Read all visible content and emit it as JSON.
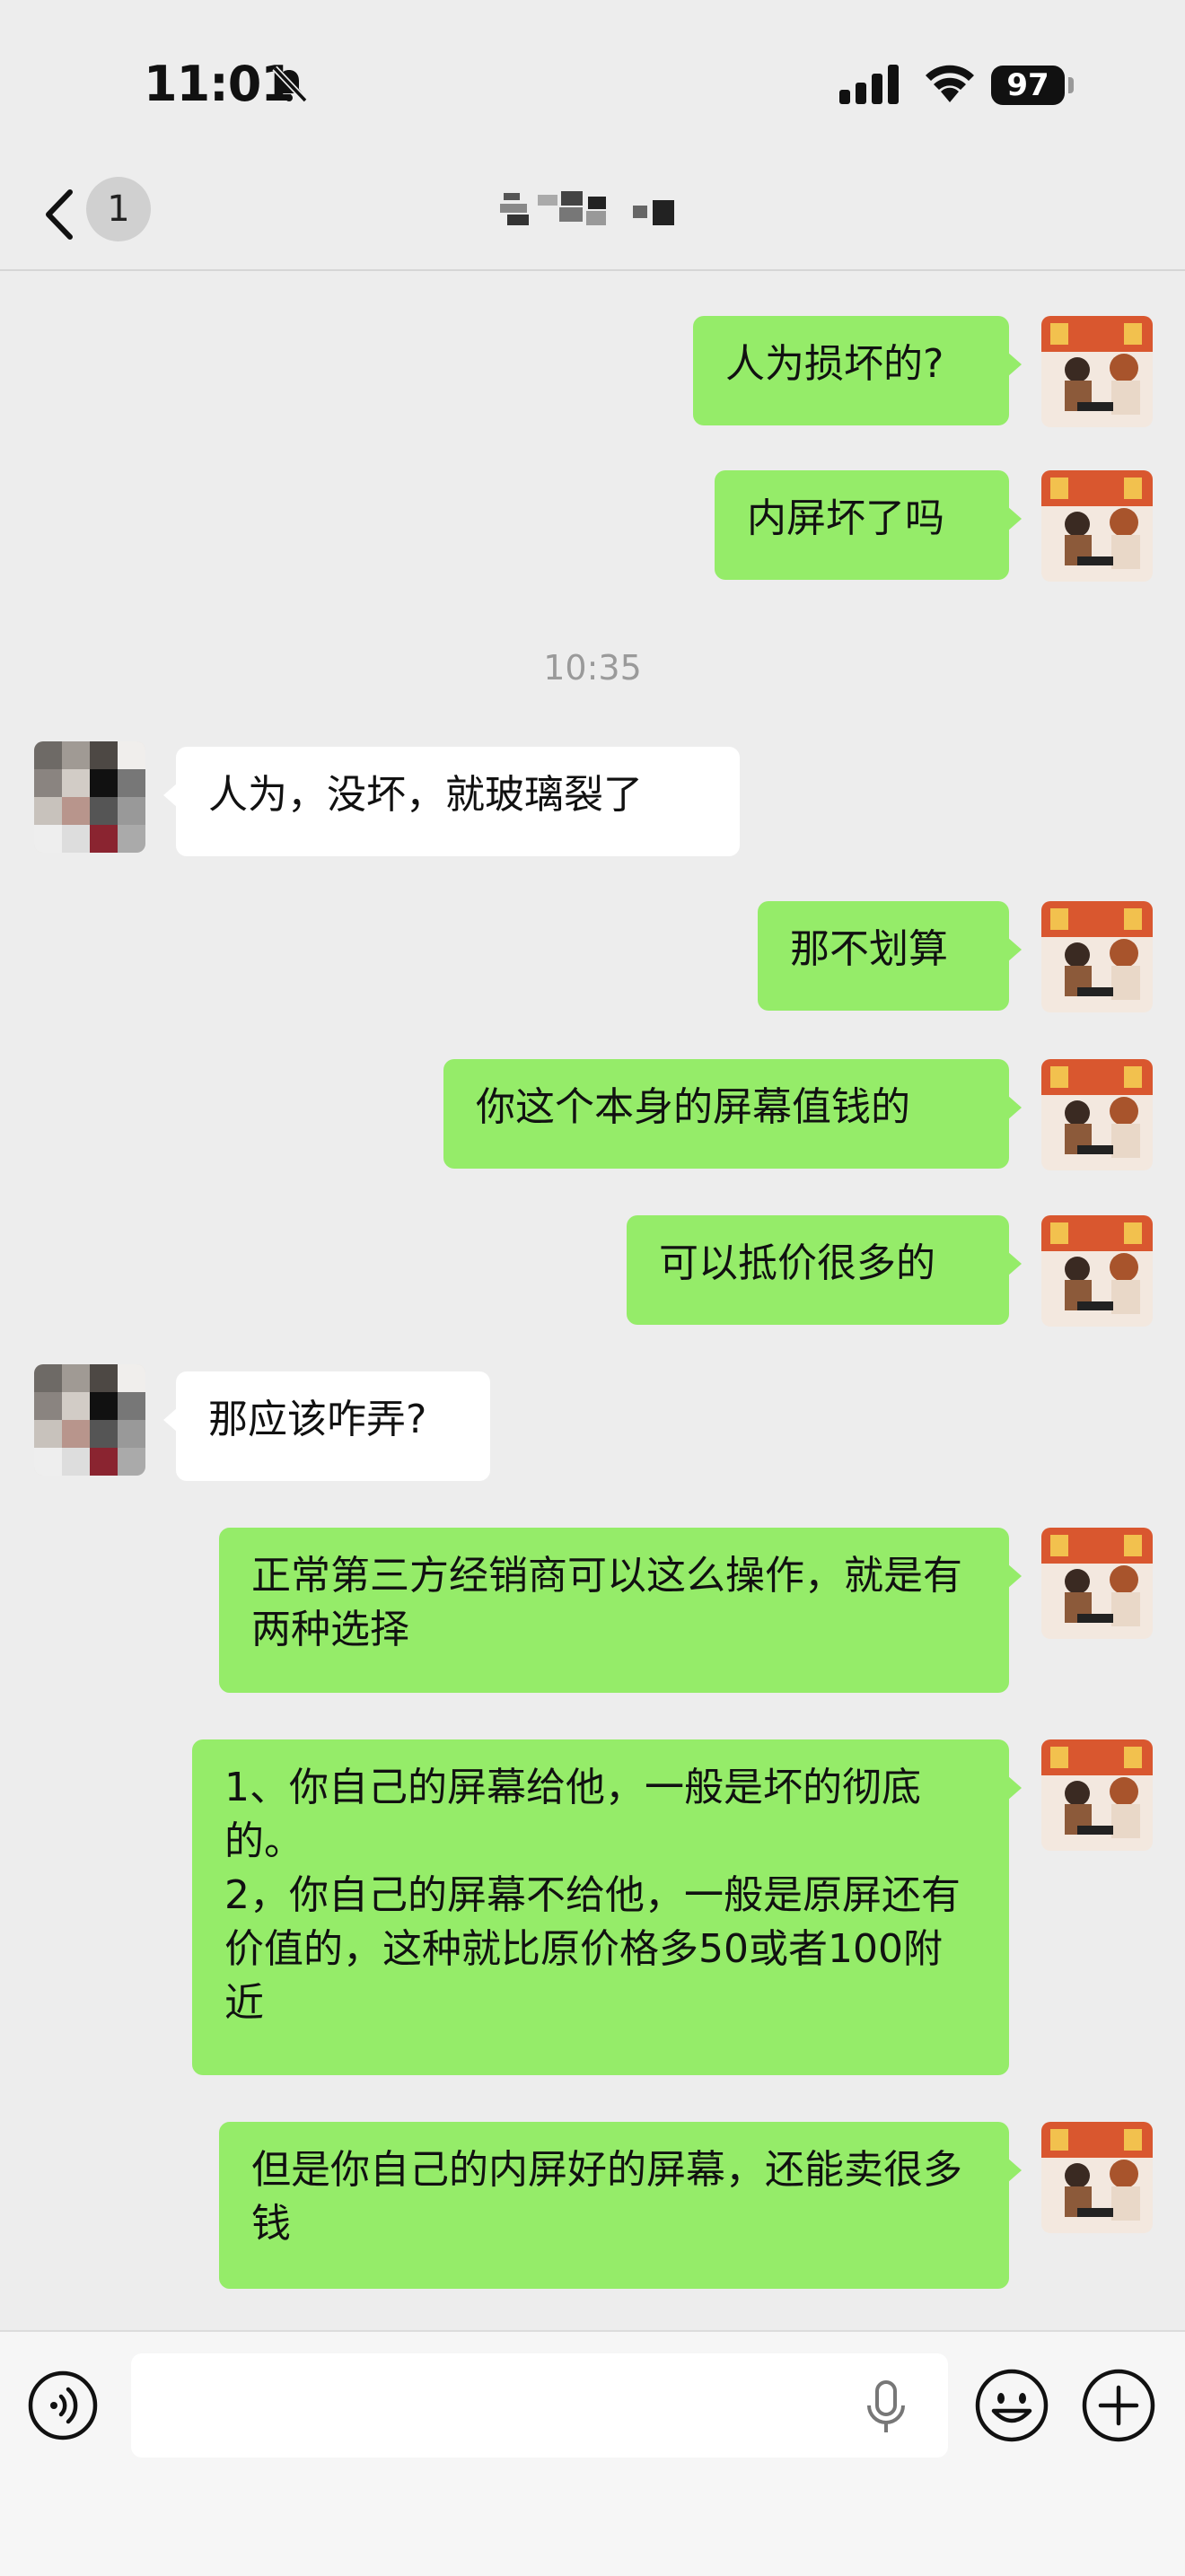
{
  "status_bar": {
    "time": "11:01",
    "battery": "97",
    "icons": [
      "bell-slash-icon",
      "signal-icon",
      "wifi-icon",
      "battery-icon"
    ]
  },
  "nav": {
    "unread_count": "1",
    "back_icon": "chevron-left-icon",
    "more_icon": "ellipsis-icon"
  },
  "divider_time": "10:35",
  "messages": [
    {
      "side": "me",
      "text": "人为损坏的?"
    },
    {
      "side": "me",
      "text": "内屏坏了吗"
    },
    {
      "side": "other",
      "text": "人为，没坏，就玻璃裂了"
    },
    {
      "side": "me",
      "text": "那不划算"
    },
    {
      "side": "me",
      "text": "你这个本身的屏幕值钱的"
    },
    {
      "side": "me",
      "text": "可以抵价很多的"
    },
    {
      "side": "other",
      "text": "那应该咋弄?"
    },
    {
      "side": "me",
      "text": "正常第三方经销商可以这么操作，就是有两种选择"
    },
    {
      "side": "me",
      "text": "1、你自己的屏幕给他，一般是坏的彻底的。\n2，你自己的屏幕不给他，一般是原屏还有价值的，这种就比原价格多50或者100附近"
    },
    {
      "side": "me",
      "text": "但是你自己的内屏好的屏幕，还能卖很多钱"
    }
  ],
  "input_bar": {
    "icons": [
      "voice-icon",
      "microphone-icon",
      "emoji-icon",
      "plus-icon"
    ]
  },
  "colors": {
    "my_bubble": "#95ec69",
    "other_bubble": "#ffffff",
    "background": "#ededed"
  }
}
